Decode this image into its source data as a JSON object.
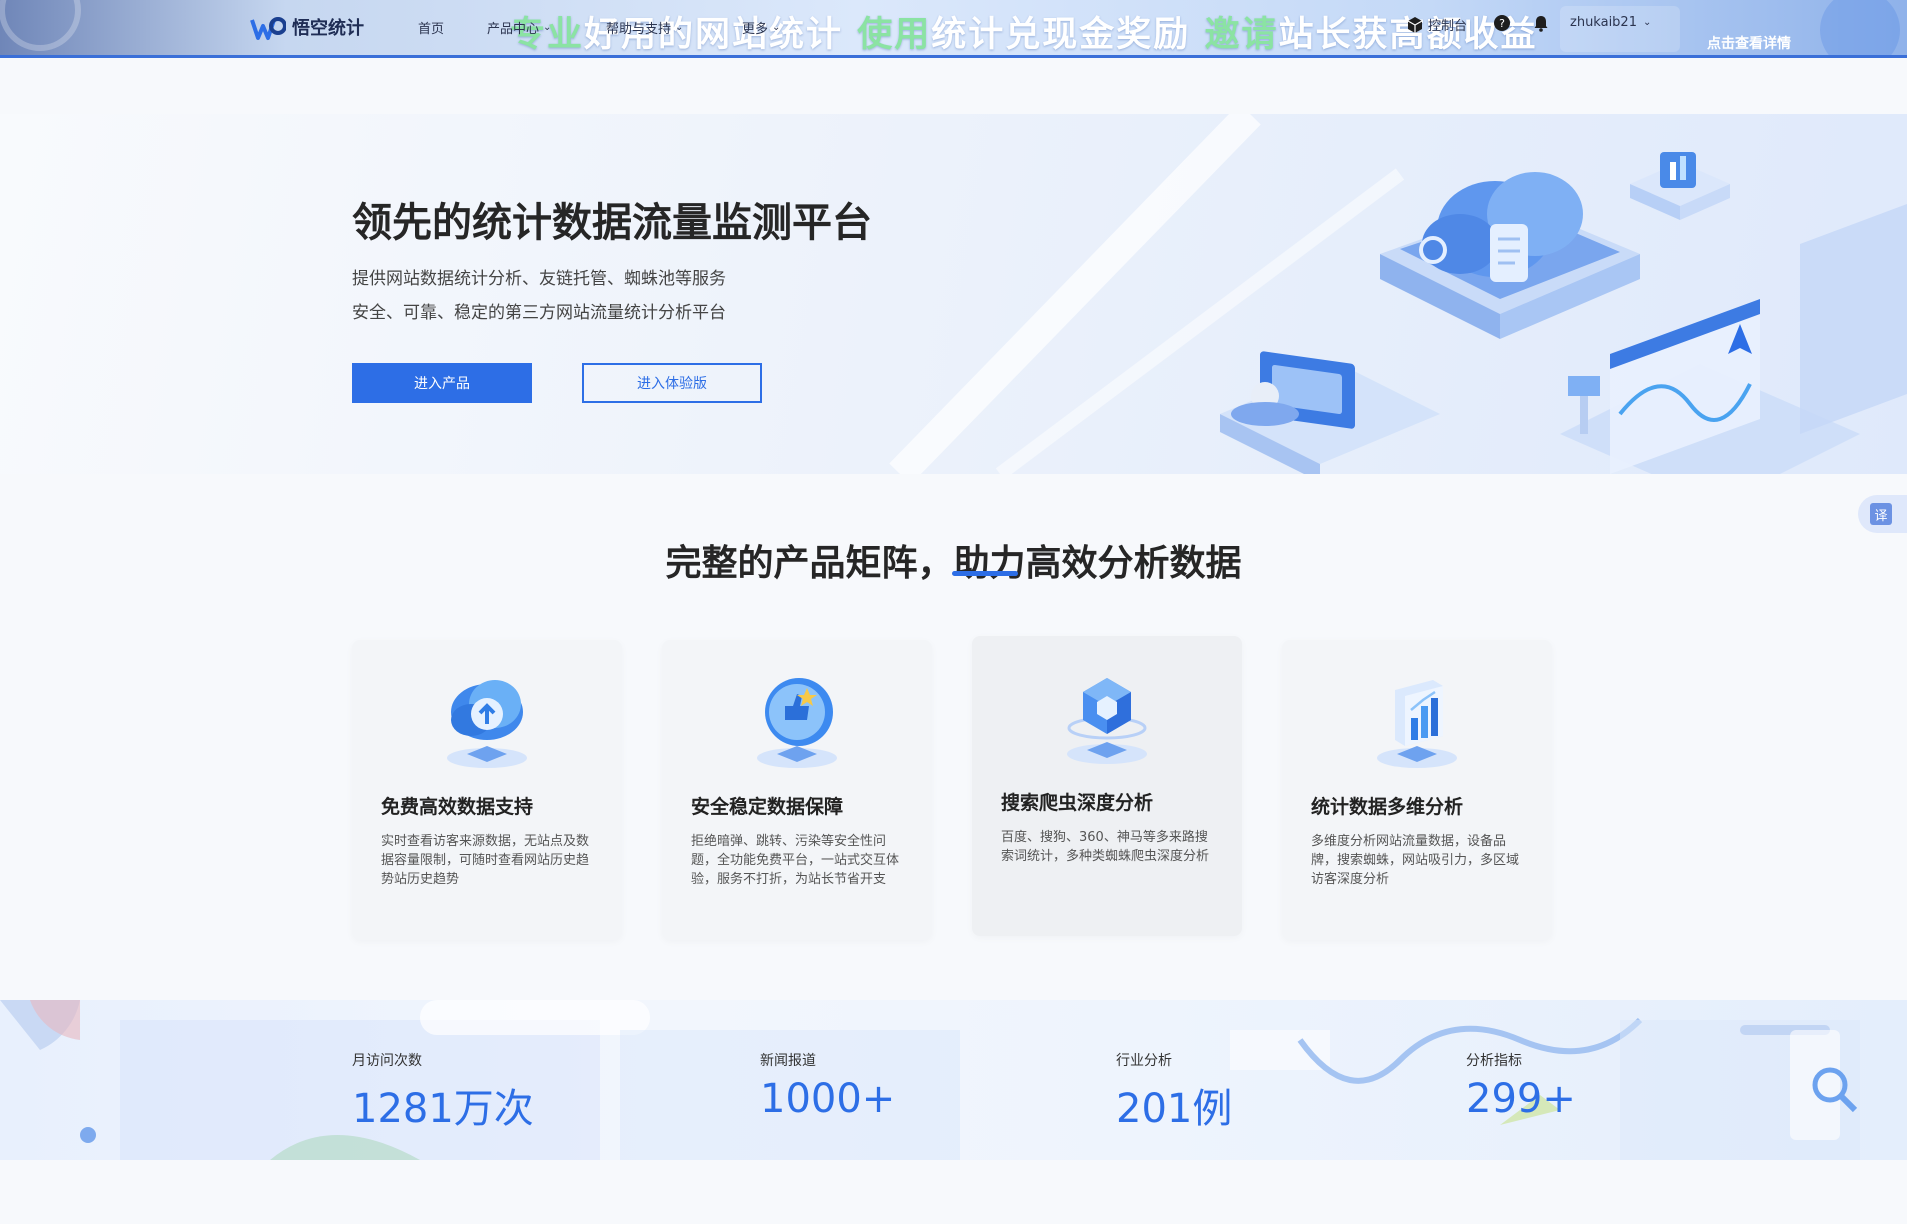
{
  "banner": {
    "slogan_hl1": "专业",
    "slogan_part1": "好用的网站统计",
    "slogan_hl2": "使用",
    "slogan_part2": "统计兑现金奖励",
    "slogan_hl3": "邀请",
    "slogan_part3": "站长获高额收益",
    "detail_link": "点击查看详情"
  },
  "nav": {
    "logo_text": "悟空统计",
    "items": [
      {
        "label": "首页",
        "has_dropdown": false
      },
      {
        "label": "产品中心",
        "has_dropdown": true
      },
      {
        "label": "帮助与支持",
        "has_dropdown": true
      },
      {
        "label": "更多",
        "has_dropdown": true
      }
    ],
    "console_label": "控制台",
    "username": "zhukaib21"
  },
  "hero": {
    "title": "领先的统计数据流量监测平台",
    "subtitle_1": "提供网站数据统计分析、友链托管、蜘蛛池等服务",
    "subtitle_2": "安全、可靠、稳定的第三方网站流量统计分析平台",
    "primary_button": "进入产品",
    "secondary_button": "进入体验版"
  },
  "translate_label": "译",
  "features": {
    "title": "完整的产品矩阵，助力高效分析数据",
    "cards": [
      {
        "title": "免费高效数据支持",
        "desc": "实时查看访客来源数据，无站点及数据容量限制，可随时查看网站历史趋势站历史趋势",
        "icon": "cloud-upload-icon"
      },
      {
        "title": "安全稳定数据保障",
        "desc": "拒绝暗弹、跳转、污染等安全性问题，全功能免费平台，一站式交互体验，服务不打折，为站长节省开支",
        "icon": "thumbs-up-shield-icon"
      },
      {
        "title": "搜索爬虫深度分析",
        "desc": "百度、搜狗、360、神马等多来路搜索词统计，多种类蜘蛛爬虫深度分析",
        "icon": "cube-crawler-icon"
      },
      {
        "title": "统计数据多维分析",
        "desc": "多维度分析网站流量数据，设备品牌，搜索蜘蛛，网站吸引力，多区域访客深度分析",
        "icon": "bar-chart-icon"
      }
    ]
  },
  "stats": [
    {
      "label": "月访问次数",
      "value": "1281万次"
    },
    {
      "label": "新闻报道",
      "value": "1000+"
    },
    {
      "label": "行业分析",
      "value": "201例"
    },
    {
      "label": "分析指标",
      "value": "299+"
    }
  ],
  "colors": {
    "accent": "#2d6ee6",
    "banner_highlight": "#8be3a3",
    "title_text": "#262626"
  }
}
